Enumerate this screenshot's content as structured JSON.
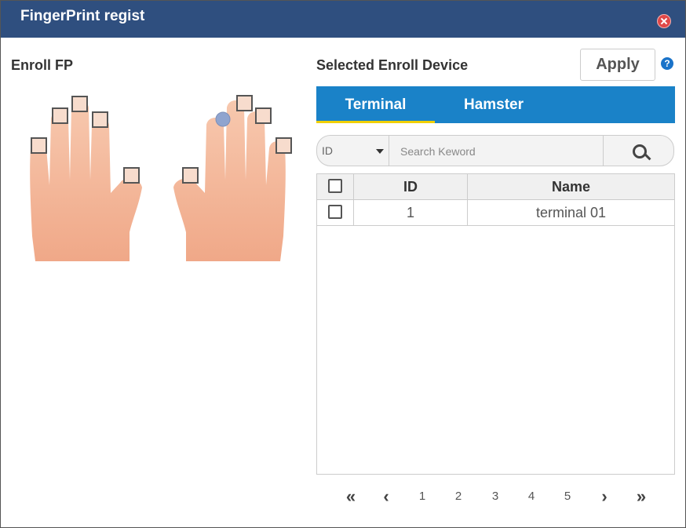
{
  "window": {
    "title": "FingerPrint regist",
    "close_icon": "close-icon"
  },
  "enroll": {
    "label": "Enroll FP"
  },
  "device": {
    "label": "Selected Enroll Device",
    "apply_label": "Apply",
    "help_glyph": "?"
  },
  "tabs": [
    {
      "label": "Terminal",
      "active": true
    },
    {
      "label": "Hamster",
      "active": false
    }
  ],
  "search": {
    "field": "ID",
    "placeholder": "Search Keword",
    "icon": "search-icon"
  },
  "table": {
    "columns": [
      "",
      "ID",
      "Name"
    ],
    "rows": [
      {
        "checked": false,
        "id": "1",
        "name": "terminal 01"
      }
    ]
  },
  "pagination": {
    "first": "«",
    "prev": "‹",
    "pages": [
      "1",
      "2",
      "3",
      "4",
      "5"
    ],
    "next": "›",
    "last": "»"
  },
  "colors": {
    "titlebar": "#2f4f7f",
    "tab_bar": "#1a82c8",
    "tab_indicator": "#f0d000",
    "skin": "#f3b99a"
  }
}
